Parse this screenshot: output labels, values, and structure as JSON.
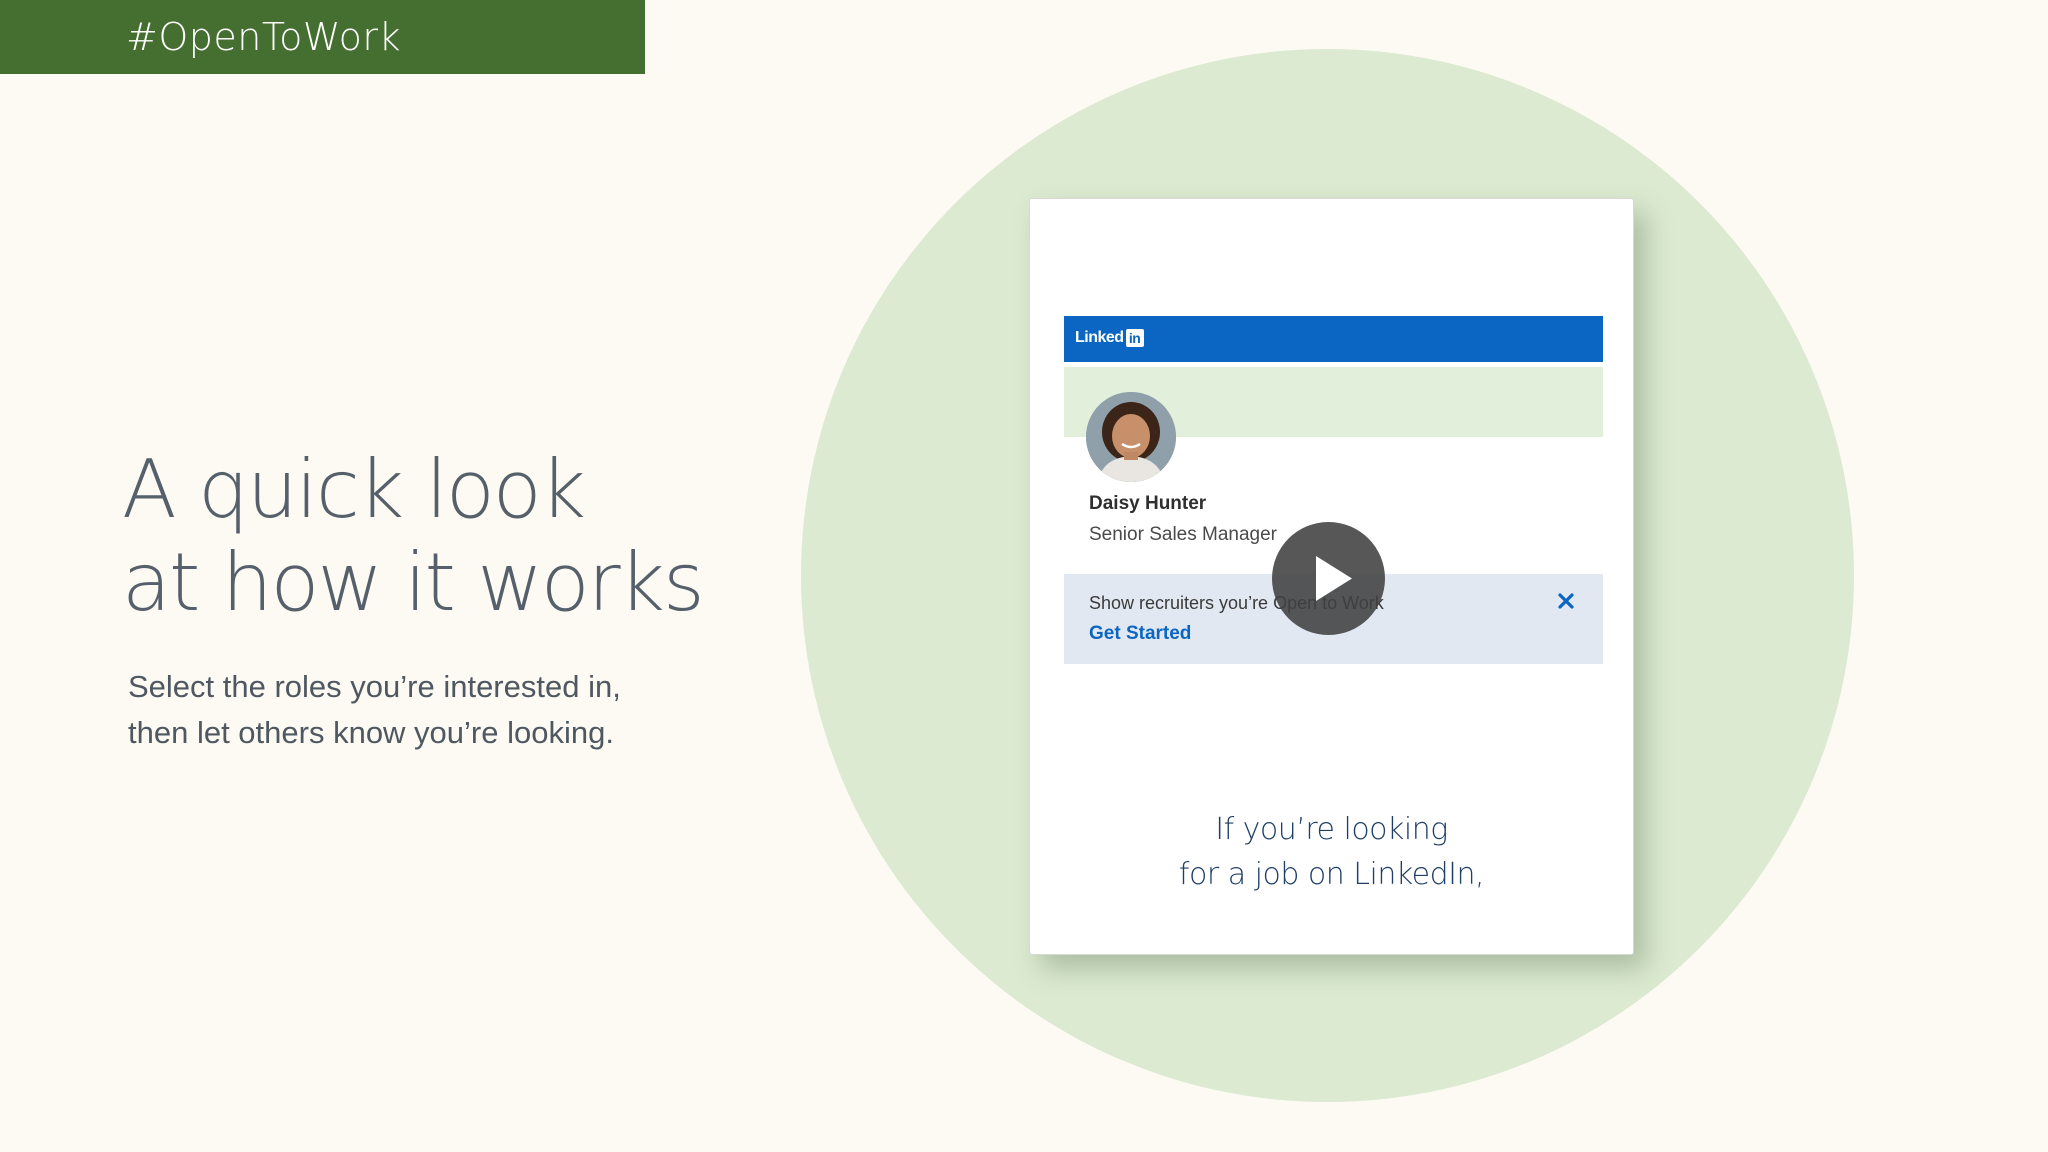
{
  "banner": {
    "hashtag": "#OpenToWork"
  },
  "headline": {
    "line1": "A quick look",
    "line2": "at how it works"
  },
  "subtext": {
    "line1": "Select the roles you’re interested in,",
    "line2": "then let others know you’re looking."
  },
  "video": {
    "linkedin_logo": {
      "word": "Linked",
      "box": "in"
    },
    "profile": {
      "name": "Daisy Hunter",
      "title": "Senior Sales Manager"
    },
    "open_to_work": {
      "prompt": "Show recruiters you’re Open to Work",
      "cta": "Get Started",
      "close_icon": "close-icon"
    },
    "play_icon": "play-icon",
    "caption": {
      "line1": "If you’re looking",
      "line2": "for a job on LinkedIn,"
    }
  },
  "colors": {
    "banner_green": "#456f31",
    "page_bg": "#fdfaf3",
    "circle_green": "#dbead0",
    "linkedin_blue": "#0a66c2",
    "cover_green": "#e2efda",
    "otw_banner_bg": "#e2e8f2",
    "caption_navy": "#1f3f66"
  }
}
